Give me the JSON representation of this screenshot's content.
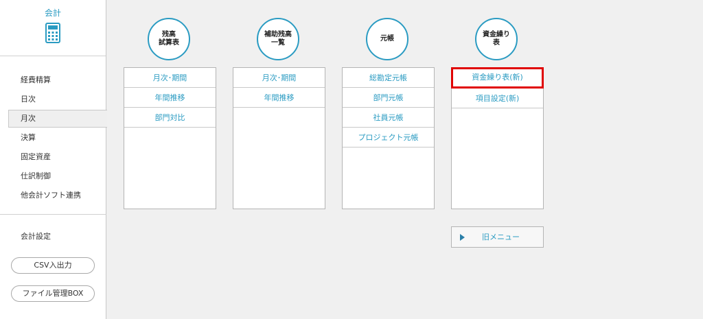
{
  "sidebar": {
    "title": "会計",
    "icon": "calculator-icon",
    "nav": [
      "経費精算",
      "日次",
      "月次",
      "決算",
      "固定資産",
      "仕訳制御",
      "他会計ソフト連携"
    ],
    "active_index": 2,
    "settings_label": "会計設定",
    "csv_button": "CSV入出力",
    "file_button": "ファイル管理BOX"
  },
  "columns": [
    {
      "title": "残高\n試算表",
      "items": [
        "月次･期間",
        "年間推移",
        "部門対比"
      ]
    },
    {
      "title": "補助残高\n一覧",
      "items": [
        "月次･期間",
        "年間推移"
      ]
    },
    {
      "title": "元帳",
      "items": [
        "総勘定元帳",
        "部門元帳",
        "社員元帳",
        "プロジェクト元帳"
      ]
    },
    {
      "title": "資金繰り\n表",
      "items": [
        "資金繰り表(新)",
        "項目設定(新)"
      ]
    }
  ],
  "highlight": {
    "column": 3,
    "item": 0,
    "color": "#e00000"
  },
  "old_menu": {
    "label": "旧メニュー",
    "icon": "triangle-right-icon"
  },
  "colors": {
    "accent": "#2a9bc2",
    "background": "#f0f0f0"
  }
}
